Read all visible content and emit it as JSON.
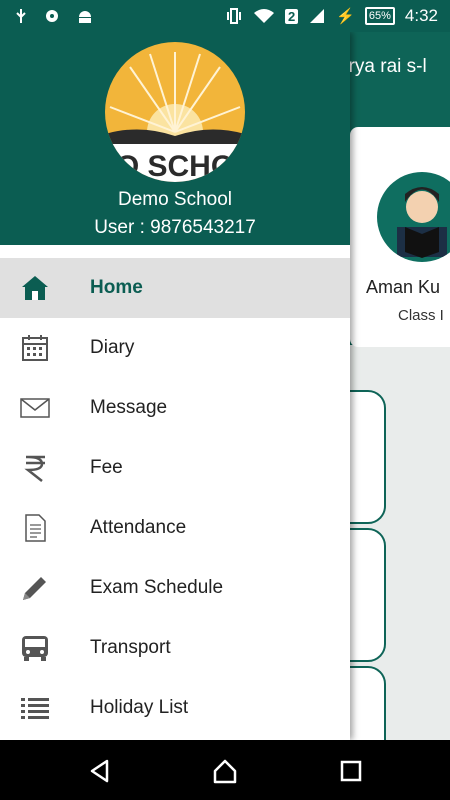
{
  "status_bar": {
    "sim_slot": "2",
    "battery": "65%",
    "time": "4:32"
  },
  "background": {
    "toolbar_title": "arya rai s-l",
    "student_name": "Aman Ku",
    "student_class": "Class I"
  },
  "drawer": {
    "logo_text": "O SCHO",
    "school_name": "Demo School",
    "user_line": "User : 9876543217",
    "menu": [
      {
        "label": "Home",
        "icon": "home-icon",
        "active": true
      },
      {
        "label": "Diary",
        "icon": "calendar-icon",
        "active": false
      },
      {
        "label": "Message",
        "icon": "envelope-icon",
        "active": false
      },
      {
        "label": "Fee",
        "icon": "rupee-icon",
        "active": false
      },
      {
        "label": "Attendance",
        "icon": "document-icon",
        "active": false
      },
      {
        "label": "Exam Schedule",
        "icon": "pencil-icon",
        "active": false
      },
      {
        "label": "Transport",
        "icon": "bus-icon",
        "active": false
      },
      {
        "label": "Holiday List",
        "icon": "list-icon",
        "active": false
      }
    ]
  },
  "colors": {
    "primary": "#0b5d52",
    "active_bg": "#e0e0e0",
    "logo_sun": "#f2b53a"
  }
}
